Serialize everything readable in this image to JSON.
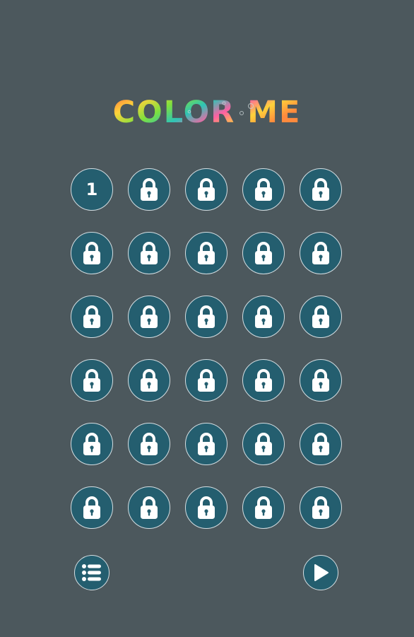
{
  "title": {
    "text": "COLOR ME"
  },
  "levels": [
    {
      "label": "1",
      "locked": false
    },
    {
      "label": "",
      "locked": true
    },
    {
      "label": "",
      "locked": true
    },
    {
      "label": "",
      "locked": true
    },
    {
      "label": "",
      "locked": true
    },
    {
      "label": "",
      "locked": true
    },
    {
      "label": "",
      "locked": true
    },
    {
      "label": "",
      "locked": true
    },
    {
      "label": "",
      "locked": true
    },
    {
      "label": "",
      "locked": true
    },
    {
      "label": "",
      "locked": true
    },
    {
      "label": "",
      "locked": true
    },
    {
      "label": "",
      "locked": true
    },
    {
      "label": "",
      "locked": true
    },
    {
      "label": "",
      "locked": true
    },
    {
      "label": "",
      "locked": true
    },
    {
      "label": "",
      "locked": true
    },
    {
      "label": "",
      "locked": true
    },
    {
      "label": "",
      "locked": true
    },
    {
      "label": "",
      "locked": true
    },
    {
      "label": "",
      "locked": true
    },
    {
      "label": "",
      "locked": true
    },
    {
      "label": "",
      "locked": true
    },
    {
      "label": "",
      "locked": true
    },
    {
      "label": "",
      "locked": true
    },
    {
      "label": "",
      "locked": true
    },
    {
      "label": "",
      "locked": true
    },
    {
      "label": "",
      "locked": true
    },
    {
      "label": "",
      "locked": true
    },
    {
      "label": "",
      "locked": true
    }
  ],
  "icons": {
    "locked_level": "lock-icon",
    "menu_button": "list-icon",
    "play_button": "play-icon"
  },
  "colors": {
    "background": "#4c585d",
    "button_fill": "#245e6f",
    "button_border": "#d4dee2",
    "icon": "#ffffff",
    "title_gradient": [
      "#ff6b3d",
      "#ffd23a",
      "#7ee03d",
      "#2ec4b6",
      "#ff5fa2",
      "#ffd23a"
    ]
  }
}
